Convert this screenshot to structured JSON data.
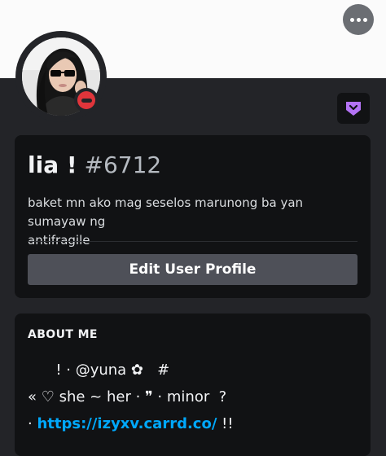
{
  "profile": {
    "username": "lia !",
    "discriminator": "#6712",
    "bio": "baket mn ako mag seselos marunong ba yan sumayaw ng\nantifragile",
    "status": "do-not-disturb",
    "edit_button_label": "Edit User Profile"
  },
  "banner": {
    "more_button_icon": "more-horizontal-icon"
  },
  "badge": {
    "icon": "nitro-badge-icon",
    "color": "#b473f5"
  },
  "about": {
    "heading": "ABOUT ME",
    "line1": "      ! · @yuna ✿   #",
    "line2": "« ♡ she ~ her · ❞ · minor  ?",
    "line3_prefix": "· ",
    "line3_link": "https://izyxv.carrd.co/",
    "line3_suffix": " !!"
  },
  "colors": {
    "background": "#232428",
    "banner": "#fbfbfb",
    "card": "#111214",
    "button": "#4e5058",
    "link": "#00a8fc",
    "dnd": "#e0353b"
  }
}
